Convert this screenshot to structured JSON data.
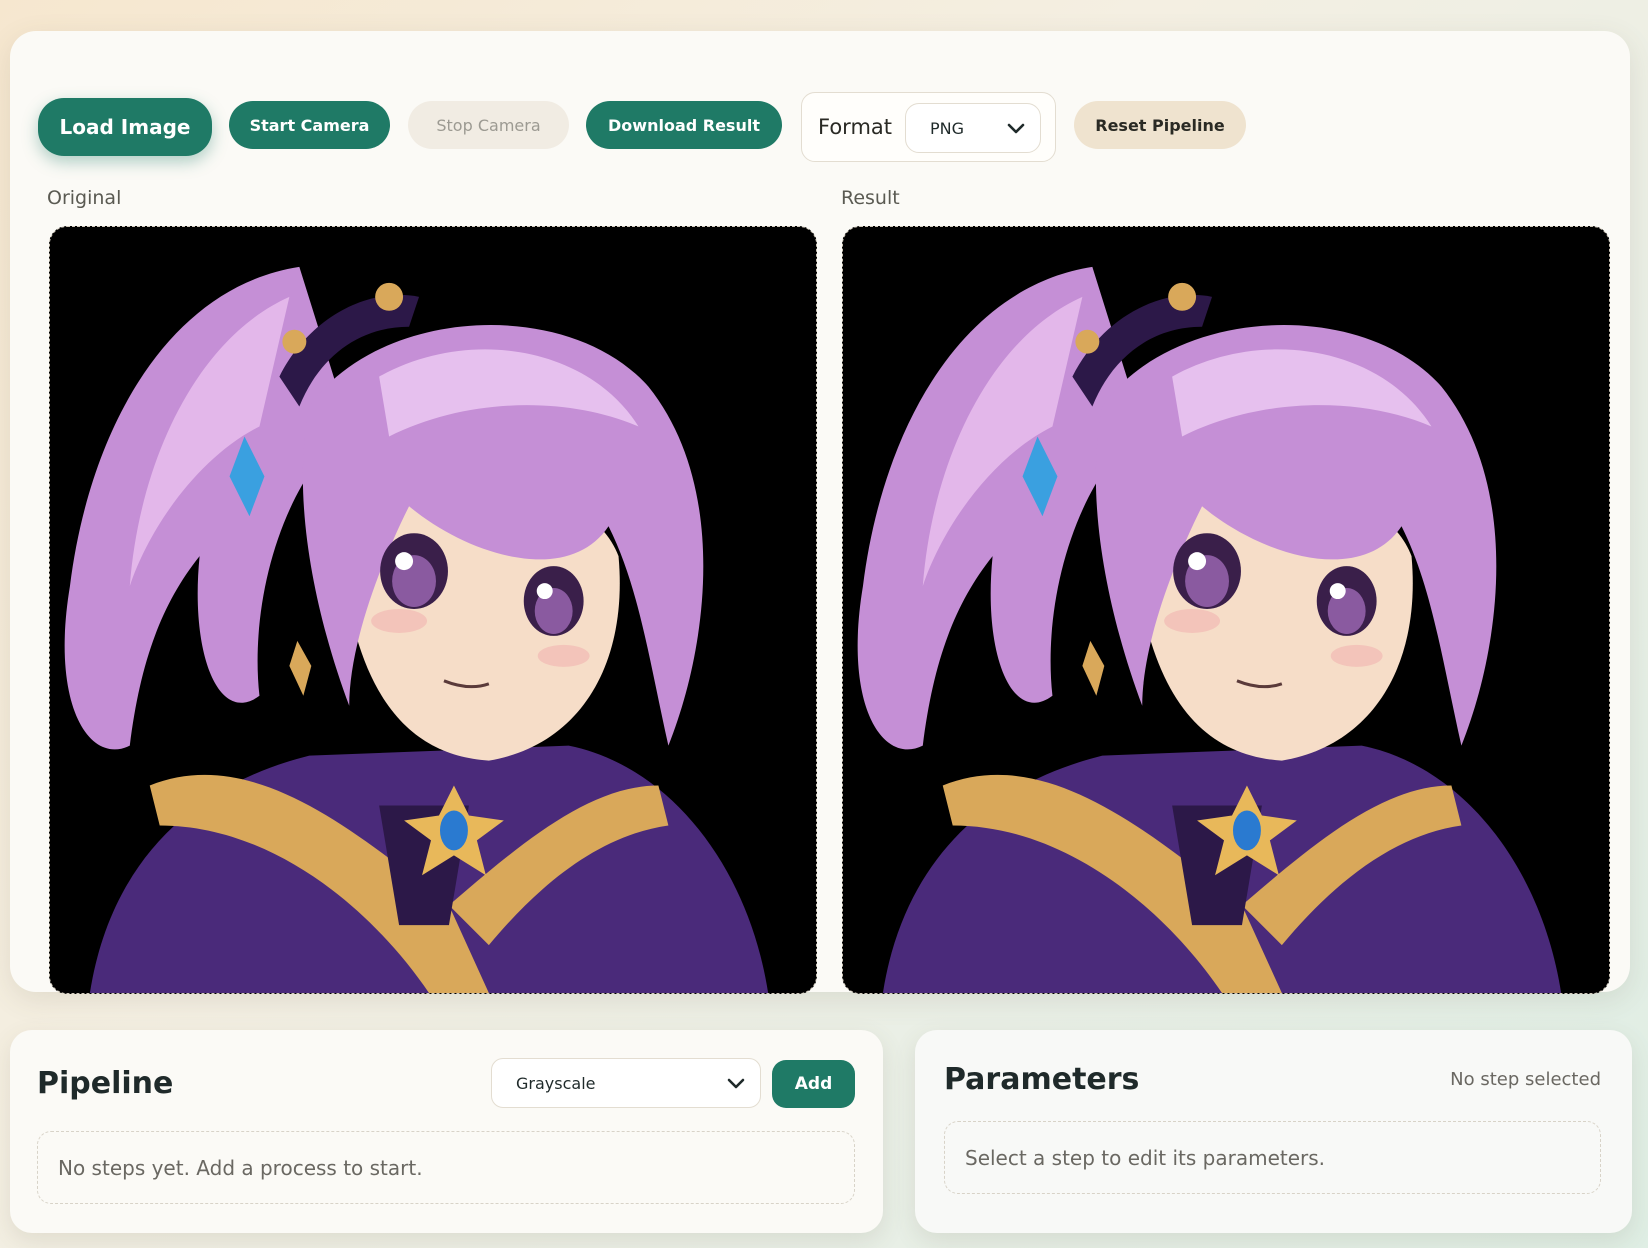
{
  "toolbar": {
    "load_label": "Load Image",
    "start_camera_label": "Start Camera",
    "stop_camera_label": "Stop Camera",
    "download_label": "Download Result",
    "format_label": "Format",
    "format_value": "PNG",
    "reset_label": "Reset Pipeline"
  },
  "viewers": {
    "original_label": "Original",
    "result_label": "Result"
  },
  "pipeline": {
    "title": "Pipeline",
    "process_value": "Grayscale",
    "add_label": "Add",
    "empty_text": "No steps yet. Add a process to start."
  },
  "parameters": {
    "title": "Parameters",
    "status": "No step selected",
    "empty_text": "Select a step to edit its parameters."
  },
  "colors": {
    "accent": "#1f7a66",
    "disabled": "#f1ece3",
    "reset": "#efe3cf"
  },
  "icons": {
    "select_chevron": "chevron-down-icon"
  }
}
